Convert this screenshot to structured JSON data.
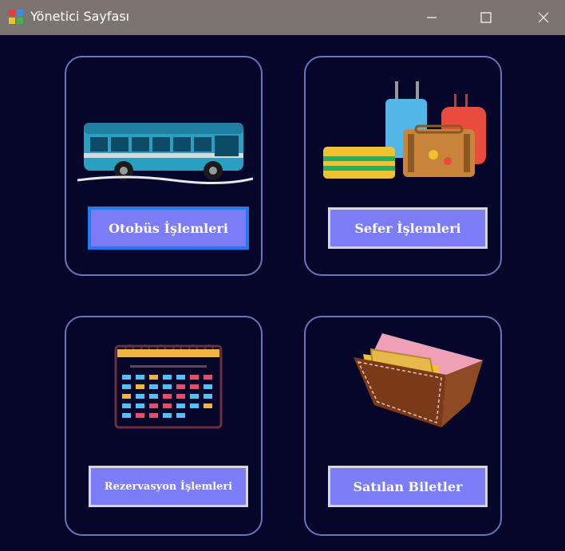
{
  "window": {
    "title": "Yönetici Sayfası"
  },
  "cards": {
    "bus": {
      "button_label": "Otobüs İşlemleri",
      "image": "bus-icon"
    },
    "trip": {
      "button_label": "Sefer İşlemleri",
      "image": "luggage-icon"
    },
    "reservation": {
      "button_label": "Rezervasyon İşlemleri",
      "image": "calendar-icon"
    },
    "sold": {
      "button_label": "Satılan Biletler",
      "image": "wallet-icon"
    }
  },
  "colors": {
    "background": "#05062a",
    "button": "#7c7cf6",
    "card_border": "#6c73b8",
    "titlebar": "#7c7470"
  }
}
